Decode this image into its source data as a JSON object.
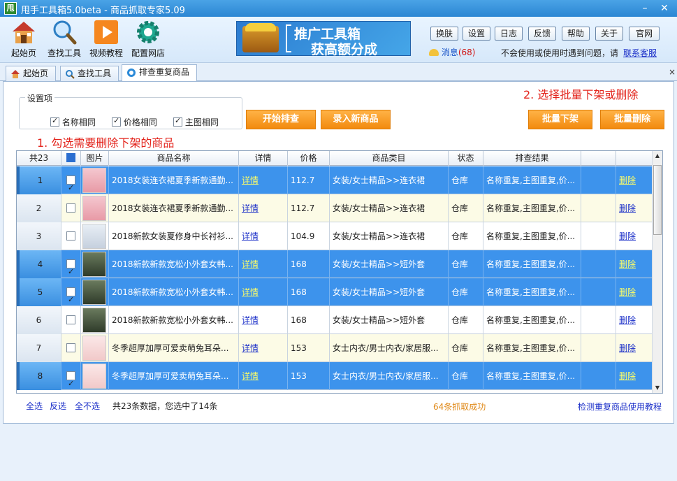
{
  "window": {
    "logo_text": "甩",
    "title": "甩手工具箱5.0beta - 商品抓取专家5.09",
    "minimize": "–",
    "close": "✕"
  },
  "toolbar": {
    "tools": [
      {
        "label": "起始页",
        "icon": "home-icon"
      },
      {
        "label": "查找工具",
        "icon": "search-icon"
      },
      {
        "label": "视频教程",
        "icon": "play-icon"
      },
      {
        "label": "配置网店",
        "icon": "gear-icon"
      }
    ],
    "promo": {
      "line1": "推广工具箱",
      "line2": "获高额分成"
    },
    "buttons": [
      "换肤",
      "设置",
      "日志",
      "反馈",
      "帮助",
      "关于",
      "官网"
    ],
    "message_label": "消息",
    "message_count": "(68)",
    "help_text": "不会使用或使用时遇到问题，请",
    "help_link": "联系客服"
  },
  "tabs": [
    {
      "label": "起始页"
    },
    {
      "label": "查找工具"
    },
    {
      "label": "排查重复商品"
    }
  ],
  "tab_close": "×",
  "settings": {
    "legend": "设置项",
    "options": [
      {
        "label": "名称相同",
        "checked": true
      },
      {
        "label": "价格相同",
        "checked": true
      },
      {
        "label": "主图相同",
        "checked": true
      }
    ]
  },
  "actions": {
    "start": "开始排查",
    "add_new": "录入新商品",
    "batch_offshelf": "批量下架",
    "batch_delete": "批量删除"
  },
  "hints": {
    "step1": "1. 勾选需要删除下架的商品",
    "step2": "2. 选择批量下架或删除"
  },
  "grid": {
    "headers": {
      "count": "共23",
      "image": "图片",
      "name": "商品名称",
      "detail": "详情",
      "price": "价格",
      "category": "商品类目",
      "status": "状态",
      "result": "排查结果"
    },
    "rows": [
      {
        "num": "1",
        "checked": true,
        "thumb": "pink",
        "name": "2018女装连衣裙夏季新款通勤...",
        "detail": "详情",
        "price": "112.7",
        "category": "女装/女士精品>>连衣裙",
        "status": "仓库",
        "result": "名称重复,主图重复,价...",
        "action": "删除"
      },
      {
        "num": "2",
        "checked": false,
        "thumb": "pink",
        "name": "2018女装连衣裙夏季新款通勤...",
        "detail": "详情",
        "price": "112.7",
        "category": "女装/女士精品>>连衣裙",
        "status": "仓库",
        "result": "名称重复,主图重复,价...",
        "action": "删除"
      },
      {
        "num": "3",
        "checked": false,
        "thumb": "white",
        "name": "2018新款女装夏修身中长衬衫...",
        "detail": "详情",
        "price": "104.9",
        "category": "女装/女士精品>>连衣裙",
        "status": "仓库",
        "result": "名称重复,主图重复,价...",
        "action": "删除"
      },
      {
        "num": "4",
        "checked": true,
        "thumb": "green",
        "name": "2018新款新款宽松小外套女韩...",
        "detail": "详情",
        "price": "168",
        "category": "女装/女士精品>>短外套",
        "status": "仓库",
        "result": "名称重复,主图重复,价...",
        "action": "删除"
      },
      {
        "num": "5",
        "checked": true,
        "thumb": "green",
        "name": "2018新款新款宽松小外套女韩...",
        "detail": "详情",
        "price": "168",
        "category": "女装/女士精品>>短外套",
        "status": "仓库",
        "result": "名称重复,主图重复,价...",
        "action": "删除"
      },
      {
        "num": "6",
        "checked": false,
        "thumb": "green",
        "name": "2018新款新款宽松小外套女韩...",
        "detail": "详情",
        "price": "168",
        "category": "女装/女士精品>>短外套",
        "status": "仓库",
        "result": "名称重复,主图重复,价...",
        "action": "删除"
      },
      {
        "num": "7",
        "checked": false,
        "thumb": "cream",
        "name": "冬季超厚加厚可爱卖萌兔耳朵...",
        "detail": "详情",
        "price": "153",
        "category": "女士内衣/男士内衣/家居服...",
        "status": "仓库",
        "result": "名称重复,主图重复,价...",
        "action": "删除"
      },
      {
        "num": "8",
        "checked": true,
        "thumb": "cream",
        "name": "冬季超厚加厚可爱卖萌兔耳朵...",
        "detail": "详情",
        "price": "153",
        "category": "女士内衣/男士内衣/家居服...",
        "status": "仓库",
        "result": "名称重复,主图重复,价...",
        "action": "删除"
      }
    ]
  },
  "footer": {
    "select_all": "全选",
    "invert": "反选",
    "select_none": "全不选",
    "summary": "共23条数据，您选中了14条",
    "success": "64条抓取成功",
    "tutorial": "检测重复商品使用教程"
  },
  "colors": {
    "selected_row": "#3d93ec",
    "accent_orange": "#f28a0e",
    "hint_red": "#e3241c"
  }
}
